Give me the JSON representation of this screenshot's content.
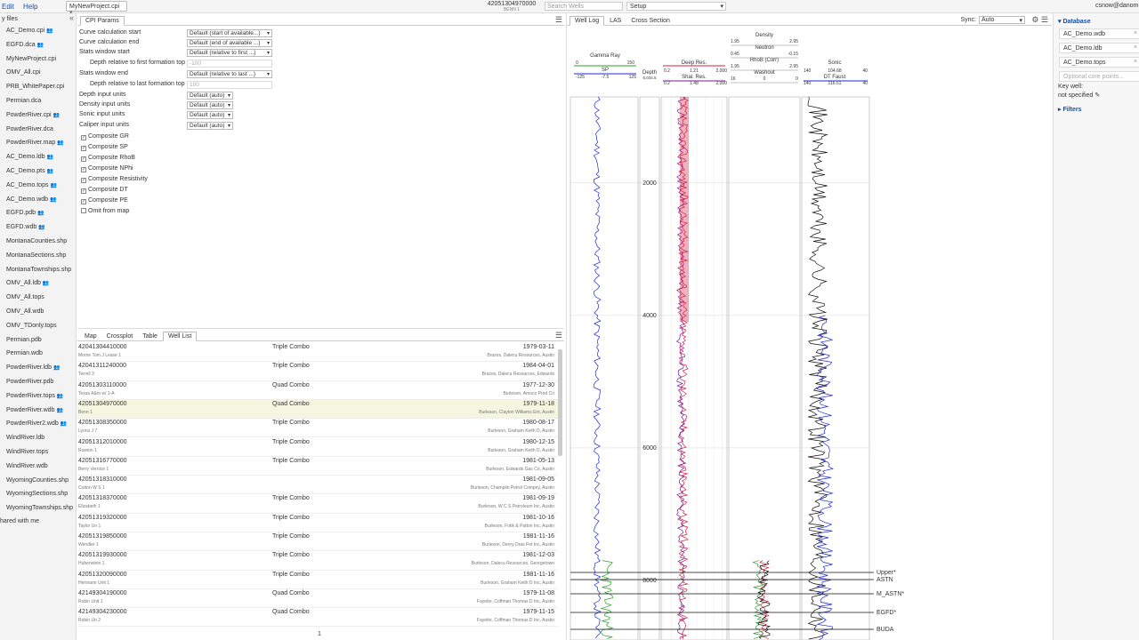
{
  "menu": {
    "edit": "Edit",
    "help": "Help"
  },
  "file_tab": "MyNewProject.cpi x",
  "well_header": {
    "api": "42051304970000",
    "name": "BENN 1"
  },
  "search": {
    "placeholder": "Search Wells"
  },
  "setup": {
    "value": "Setup"
  },
  "user": "csnow@danom",
  "files": {
    "header": "y files",
    "items": [
      {
        "name": "AC_Demo.cpi",
        "shared": true
      },
      {
        "name": "EGFD.dca",
        "shared": true
      },
      {
        "name": "MyNewProject.cpi",
        "shared": false
      },
      {
        "name": "OMV_All.cpi",
        "shared": false
      },
      {
        "name": "PRB_WhitePaper.cpi",
        "shared": false
      },
      {
        "name": "Permian.dca",
        "shared": false
      },
      {
        "name": "PowderRiver.cpi",
        "shared": true
      },
      {
        "name": "PowderRiver.dca",
        "shared": false
      },
      {
        "name": "PowderRiver.map",
        "shared": true
      },
      {
        "name": "AC_Demo.ldb",
        "shared": true
      },
      {
        "name": "AC_Demo.pts",
        "shared": true
      },
      {
        "name": "AC_Demo.tops",
        "shared": true
      },
      {
        "name": "AC_Demo.wdb",
        "shared": true
      },
      {
        "name": "EGFD.pdb",
        "shared": true
      },
      {
        "name": "EGFD.wdb",
        "shared": true
      },
      {
        "name": "MontanaCounties.shp",
        "shared": false
      },
      {
        "name": "MontanaSections.shp",
        "shared": false
      },
      {
        "name": "MontanaTownships.shp",
        "shared": false
      },
      {
        "name": "OMV_All.ldb",
        "shared": true
      },
      {
        "name": "OMV_All.tops",
        "shared": false
      },
      {
        "name": "OMV_All.wdb",
        "shared": false
      },
      {
        "name": "OMV_TDonly.tops",
        "shared": false
      },
      {
        "name": "Permian.pdb",
        "shared": false
      },
      {
        "name": "Permian.wdb",
        "shared": false
      },
      {
        "name": "PowderRiver.ldb",
        "shared": true
      },
      {
        "name": "PowderRiver.pdb",
        "shared": false
      },
      {
        "name": "PowderRiver.tops",
        "shared": true
      },
      {
        "name": "PowderRiver.wdb",
        "shared": true
      },
      {
        "name": "PowderRiver2.wdb",
        "shared": true
      },
      {
        "name": "WindRiver.ldb",
        "shared": false
      },
      {
        "name": "WindRiver.tops",
        "shared": false
      },
      {
        "name": "WindRiver.wdb",
        "shared": false
      },
      {
        "name": "WyomingCounties.shp",
        "shared": false
      },
      {
        "name": "WyomingSections.shp",
        "shared": false
      },
      {
        "name": "WyomingTownships.shp",
        "shared": false
      }
    ],
    "footer": "hared with me"
  },
  "cpi": {
    "tab": "CPI Params",
    "params": [
      {
        "label": "Curve calculation start",
        "value": "Default (start of available...)"
      },
      {
        "label": "Curve calculation end",
        "value": "Default (end of available ...)"
      },
      {
        "label": "Stats window start",
        "value": "Default (relative to first ...)"
      },
      {
        "label": "Depth relative to first formation top",
        "value": "-100",
        "disabled": true
      },
      {
        "label": "Stats window end",
        "value": "Default (relative to last ...)"
      },
      {
        "label": "Depth relative to last formation top",
        "value": "100",
        "disabled": true
      },
      {
        "label": "Depth input units",
        "value": "Default (auto)"
      },
      {
        "label": "Density input units",
        "value": "Default (auto)"
      },
      {
        "label": "Sonic input units",
        "value": "Default (auto)"
      },
      {
        "label": "Caliper input units",
        "value": "Default (auto)"
      }
    ],
    "checks": [
      {
        "label": "Composite GR",
        "checked": true
      },
      {
        "label": "Composite SP",
        "checked": true
      },
      {
        "label": "Composite RhoB",
        "checked": true
      },
      {
        "label": "Composite NPhi",
        "checked": true
      },
      {
        "label": "Composite Resistivity",
        "checked": true
      },
      {
        "label": "Composite DT",
        "checked": true
      },
      {
        "label": "Composite PE",
        "checked": true
      },
      {
        "label": "Omit from map",
        "checked": false
      }
    ]
  },
  "bottom_tabs": [
    "Map",
    "Crossplot",
    "Table",
    "Well List"
  ],
  "wells": [
    {
      "api": "42041304410000",
      "name": "Moore Tom J Lease 1",
      "type": "Triple Combo",
      "date": "1979-03-11",
      "op": "Brazos, Dalecu Resources, Austin"
    },
    {
      "api": "42041311240000",
      "name": "Terrell 3",
      "type": "Triple Combo",
      "date": "1984-04-01",
      "op": "Brazos, Dalecu Resources, Edwards"
    },
    {
      "api": "42051303110000",
      "name": "Texas A&m w/ 1-A",
      "type": "Quad Combo",
      "date": "1977-12-30",
      "op": "Burleson, Amoco Prod Co"
    },
    {
      "api": "42051304970000",
      "name": "Benn 1",
      "type": "Quad Combo",
      "date": "1979-11-18",
      "op": "Burleson, Clayton Williams Ent, Austin",
      "selected": true
    },
    {
      "api": "42051308350000",
      "name": "Lyons J 7",
      "type": "Triple Combo",
      "date": "1980-08-17",
      "op": "Burleson, Graham Keith D, Austin"
    },
    {
      "api": "42051312010000",
      "name": "Ruwion 1",
      "type": "Triple Combo",
      "date": "1980-12-15",
      "op": "Burleson, Graham Keith D, Austin"
    },
    {
      "api": "42051316770000",
      "name": "Berry Vernice 1",
      "type": "Triple Combo",
      "date": "1981-05-13",
      "op": "Burleson, Edwards Gas Co, Austin"
    },
    {
      "api": "42051318310000",
      "name": "Cotton W S 1",
      "type": "",
      "date": "1981-09-05",
      "op": "Burleson, Champlin Petrol Compny, Austin"
    },
    {
      "api": "42051318370000",
      "name": "Elizabeth 1",
      "type": "Triple Combo",
      "date": "1981-09-19",
      "op": "Burleson, W C S Petroleum Inc, Austin"
    },
    {
      "api": "42051319320000",
      "name": "Taylor Un 1",
      "type": "Triple Combo",
      "date": "1981-10-16",
      "op": "Burleson, Fotik & Patton Inc, Austin"
    },
    {
      "api": "42051319850000",
      "name": "Wendler 1",
      "type": "Triple Combo",
      "date": "1981-11-16",
      "op": "Burleson, Denry Dras Pet Inc, Austin"
    },
    {
      "api": "42051319930000",
      "name": "Hubenstein 1",
      "type": "Triple Combo",
      "date": "1981-12-03",
      "op": "Burleson, Dalecu Resources, Georgetown"
    },
    {
      "api": "42051320090000",
      "name": "Hermann Unit 1",
      "type": "Triple Combo",
      "date": "1981-11-16",
      "op": "Burleson, Graham Keith D Inc, Austin"
    },
    {
      "api": "42149304190000",
      "name": "Robin Unit 1",
      "type": "Quad Combo",
      "date": "1979-11-08",
      "op": "Fayette, Coffman Thomas D Inc, Austin"
    },
    {
      "api": "42149304230000",
      "name": "Robin Un 2",
      "type": "Quad Combo",
      "date": "1979-11-15",
      "op": "Fayette, Coffman Thomas D Inc, Austin"
    }
  ],
  "page": "1",
  "log_tabs": [
    "Well Log",
    "LAS",
    "Cross Section"
  ],
  "sync": {
    "label": "Sync:",
    "value": "Auto"
  },
  "tracks": {
    "gamma": {
      "title": "Gamma Ray",
      "min": "0",
      "max": "150",
      "sp": "SP",
      "sp_min": "-125",
      "sp_mid": "-7.5",
      "sp_max": "125"
    },
    "depth": {
      "title": "Depth",
      "sub": "6,034.5"
    },
    "res": {
      "deep": "Deep Res.",
      "shal": "Shal. Res.",
      "dmin": "0.2",
      "dmid": "1.21",
      "dmax": "2,000",
      "smin": "0.2",
      "smid": "1.48",
      "smax": "2,000"
    },
    "dens": {
      "density": "Density",
      "d_min": "1.95",
      "d_max": "2.95",
      "neutron": "Neutron",
      "n_min": "0.45",
      "n_max": "-0.15",
      "rhob": "RhoB (Corr)",
      "r_min": "1.95",
      "r_max": "2.95",
      "washout": "Washout",
      "w_min": "16",
      "w_mid": "0",
      "w_max": "0"
    },
    "sonic": {
      "title": "Sonic",
      "s_min": "140",
      "s_mid": "104.68",
      "s_max": "40",
      "dt": "DT Faust",
      "dt_min": "140",
      "dt_mid": "116.51",
      "dt_max": "40"
    }
  },
  "depth_ticks": [
    "2000",
    "4000",
    "6000",
    "8000"
  ],
  "tops": [
    "Upper*",
    "ASTN",
    "M_ASTN*",
    "EGFD*",
    "BUDA"
  ],
  "right": {
    "database": "Database",
    "items": [
      "AC_Demo.wdb",
      "AC_Demo.ldb",
      "AC_Demo.tops"
    ],
    "core_placeholder": "Optional core points...",
    "key_well": "Key well:",
    "not_specified": "not specified",
    "filters": "Filters"
  },
  "colors": {
    "accent": "#1a4fa0",
    "selected_row": "#f4f6e0",
    "sp_curve": "#1f2ad6",
    "deep_res": "#d42040",
    "gr_fill": "#2aa02a"
  }
}
